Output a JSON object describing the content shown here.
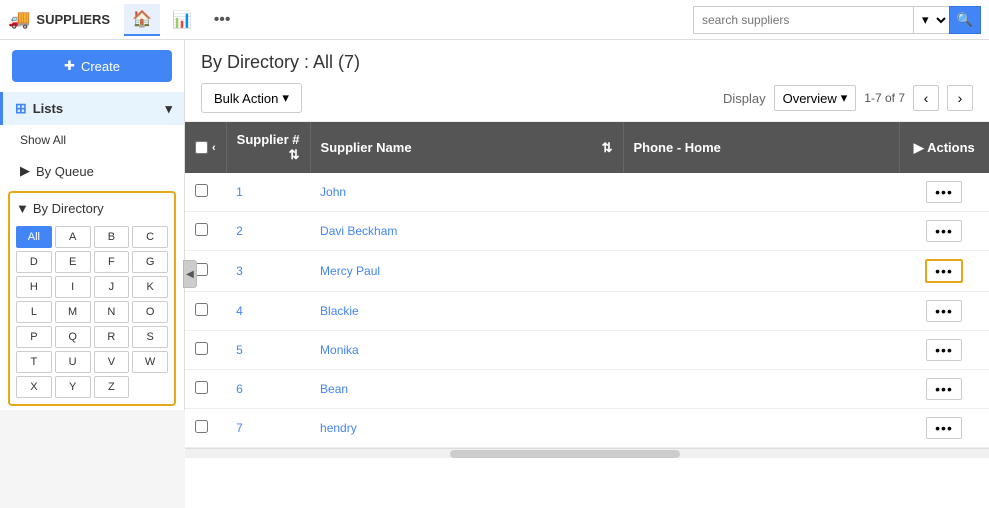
{
  "brand": {
    "icon": "🚚",
    "label": "SUPPLIERS"
  },
  "nav": {
    "home_icon": "🏠",
    "chart_icon": "📊",
    "more_icon": "•••",
    "search_placeholder": "search suppliers"
  },
  "sidebar": {
    "create_label": "Create",
    "lists_label": "Lists",
    "show_all_label": "Show All",
    "by_queue_label": "By Queue",
    "by_directory_label": "By Directory",
    "directory_buttons": [
      "All",
      "A",
      "B",
      "C",
      "D",
      "E",
      "F",
      "G",
      "H",
      "I",
      "J",
      "K",
      "L",
      "M",
      "N",
      "O",
      "P",
      "Q",
      "R",
      "S",
      "T",
      "U",
      "V",
      "W",
      "X",
      "Y",
      "Z"
    ]
  },
  "content": {
    "title": "By Directory : All (7)",
    "bulk_action_label": "Bulk Action",
    "display_label": "Display",
    "display_option": "Overview",
    "pagination_info": "1-7 of 7",
    "columns": {
      "supplier_num": "Supplier #",
      "supplier_name": "Supplier Name",
      "phone_home": "Phone - Home",
      "actions": "Actions"
    },
    "rows": [
      {
        "id": 1,
        "num": "1",
        "name": "John",
        "phone": "",
        "actions_highlighted": false
      },
      {
        "id": 2,
        "num": "2",
        "name": "Davi Beckham",
        "phone": "",
        "actions_highlighted": false
      },
      {
        "id": 3,
        "num": "3",
        "name": "Mercy Paul",
        "phone": "",
        "actions_highlighted": true
      },
      {
        "id": 4,
        "num": "4",
        "name": "Blackie",
        "phone": "",
        "actions_highlighted": false
      },
      {
        "id": 5,
        "num": "5",
        "name": "Monika",
        "phone": "",
        "actions_highlighted": false
      },
      {
        "id": 6,
        "num": "6",
        "name": "Bean",
        "phone": "",
        "actions_highlighted": false
      },
      {
        "id": 7,
        "num": "7",
        "name": "hendry",
        "phone": "",
        "actions_highlighted": false
      }
    ]
  }
}
